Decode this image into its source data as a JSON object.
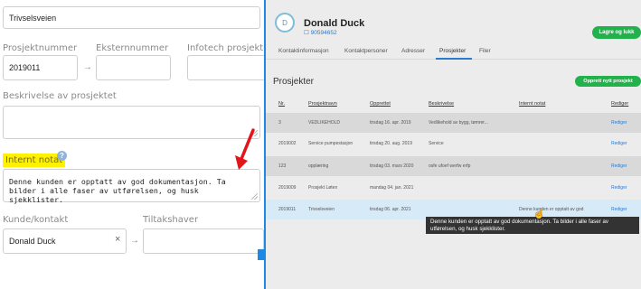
{
  "form": {
    "project_name_value": "Trivselsveien",
    "project_number_label": "Prosjektnummer",
    "project_number_value": "2019011",
    "external_number_label": "Eksternnummer",
    "external_number_value": "",
    "infotech_label": "Infotech prosjekt-id",
    "infotech_value": "",
    "description_label": "Beskrivelse av prosjektet",
    "description_value": "",
    "internal_note_label": "Internt notat",
    "help_icon_text": "?",
    "internal_note_value": "Denne kunden er opptatt av god dokumentasjon. Ta bilder i alle faser av utførelsen, og husk sjekklister.",
    "customer_contact_label": "Kunde/kontakt",
    "customer_contact_value": "Donald Duck",
    "clear_symbol": "×",
    "action_owner_label": "Tiltakshaver",
    "action_owner_value": "",
    "arrow_symbol": "→"
  },
  "customer": {
    "avatar_text": "D",
    "name": "Donald Duck",
    "phone": "90594652",
    "save_label": "Lagre og lukk"
  },
  "tabs": [
    {
      "label": "Kontaktinformasjon"
    },
    {
      "label": "Kontaktpersoner"
    },
    {
      "label": "Adresser"
    },
    {
      "label": "Prosjekter"
    },
    {
      "label": "Filer"
    }
  ],
  "active_tab": "Prosjekter",
  "projects": {
    "title": "Prosjekter",
    "new_label": "Opprett nytt prosjekt",
    "columns": [
      "Nr.",
      "Prosjektnavn",
      "Opprettet",
      "Beskrivelse",
      "Internt notat",
      "Rediger"
    ],
    "rows": [
      {
        "nr": "3",
        "name": "VEDLIKEHOLD",
        "created": "tirsdag 16. apr. 2019",
        "description": "Vedlikehold av bygg, tømrer...",
        "note": "",
        "edit": "Rediger"
      },
      {
        "nr": "2019002",
        "name": "Service pumpestasjon",
        "created": "tirsdag 20. aug. 2019",
        "description": "Service",
        "note": "",
        "edit": "Rediger"
      },
      {
        "nr": "123",
        "name": "opplæring",
        "created": "tirsdag 03. mars 2020",
        "description": "osfe ufoef werfw erfp",
        "note": "",
        "edit": "Rediger"
      },
      {
        "nr": "2019009",
        "name": "Prosjekt Løten",
        "created": "mandag 04. jan. 2021",
        "description": "",
        "note": "",
        "edit": "Rediger"
      },
      {
        "nr": "2019011",
        "name": "Trivselsveien",
        "created": "tirsdag 06. apr. 2021",
        "description": "",
        "note": "Denne kunden er opptatt av god",
        "edit": "Rediger"
      }
    ],
    "tooltip": "Denne kunden er opptatt av god dokumentasjon. Ta bilder i alle faser av utførelsen, og husk sjekklister."
  },
  "colors": {
    "highlight": "#fff200",
    "accent": "#1e88e5",
    "button_green": "#22b24c",
    "link_blue": "#2a7ad0"
  }
}
